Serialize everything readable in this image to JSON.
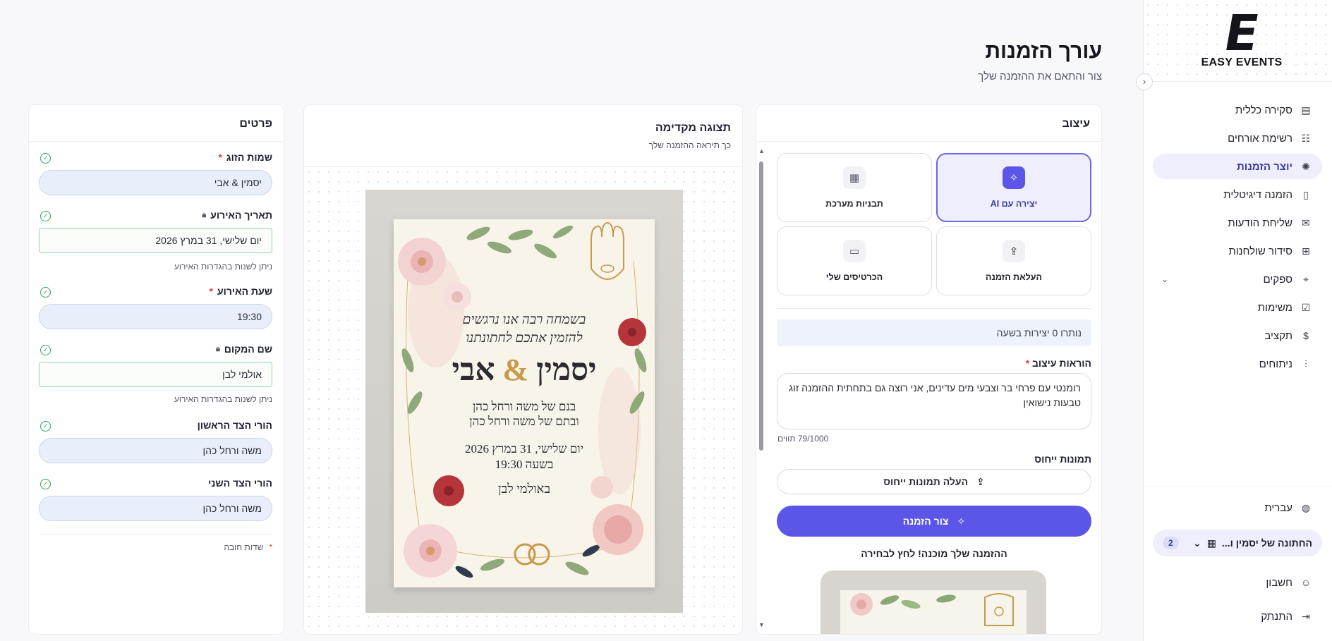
{
  "brand": {
    "logo_mark": "E",
    "logo_text": "EASY EVENTS"
  },
  "sidebar": {
    "collapse_icon": "chevron-left-icon",
    "items": [
      {
        "label": "סקירה כללית",
        "icon": "dashboard-icon",
        "glyph": "▤"
      },
      {
        "label": "רשימת אורחים",
        "icon": "guests-icon",
        "glyph": "☷"
      },
      {
        "label": "יוצר הזמנות",
        "icon": "sparkle-icon",
        "glyph": "✺"
      },
      {
        "label": "הזמנה דיגיטלית",
        "icon": "phone-icon",
        "glyph": "▯"
      },
      {
        "label": "שליחת הודעות",
        "icon": "message-icon",
        "glyph": "✉"
      },
      {
        "label": "סידור שולחנות",
        "icon": "tables-icon",
        "glyph": "⊞"
      },
      {
        "label": "ספקים",
        "icon": "location-icon",
        "glyph": "⌖"
      },
      {
        "label": "משימות",
        "icon": "tasks-icon",
        "glyph": "☑"
      },
      {
        "label": "תקציב",
        "icon": "budget-icon",
        "glyph": "$"
      },
      {
        "label": "ניתוחים",
        "icon": "analytics-icon",
        "glyph": "⫶"
      }
    ],
    "language": "עברית",
    "event_name": "החתונה של יסמין ו...",
    "event_count": "2",
    "account": "חשבון",
    "logout": "התנתק"
  },
  "header": {
    "title": "עורך הזמנות",
    "subtitle": "צור והתאם את ההזמנה שלך"
  },
  "design": {
    "title": "עיצוב",
    "options": [
      {
        "label": "יצירה עם AI",
        "icon": "ai-sparkle-icon",
        "glyph": "✧"
      },
      {
        "label": "תבניות מערכת",
        "icon": "template-icon",
        "glyph": "▦"
      },
      {
        "label": "העלאת הזמנה",
        "icon": "upload-icon",
        "glyph": "⇪"
      },
      {
        "label": "הכרטיסים שלי",
        "icon": "folder-icon",
        "glyph": "▭"
      }
    ],
    "credits": "נותרו 0 יצירות בשעה",
    "instructions_label": "הוראות עיצוב",
    "instructions_value": "רומנטי עם פרחי בר וצבעי מים עדינים, אני רוצה גם בתחתית ההזמנה זוג טבעות נישואין",
    "char_count": "79/1000 תווים",
    "reference_label": "תמונות ייחוס",
    "upload_label": "העלה תמונות ייחוס",
    "create_label": "צור הזמנה",
    "ready_text": "ההזמנה שלך מוכנה! לחץ לבחירה"
  },
  "preview": {
    "title": "תצוגה מקדימה",
    "subtitle": "כך תיראה ההזמנה שלך",
    "card": {
      "line1": "בשמחה רבה אנו נרגשים",
      "line2": "להזמין אתכם לחתונתנו",
      "bride": "יסמין",
      "amp": "&",
      "groom": "אבי",
      "parents1": "בנם של משה ורחל כהן",
      "parents2": "ובתם של משה ורחל כהן",
      "date": "יום שלישי, 31 במרץ 2026",
      "time": "בשעה 19:30",
      "venue": "באולמי לבן"
    }
  },
  "details": {
    "title": "פרטים",
    "fields": {
      "couple_label": "שמות הזוג",
      "couple_value": "יסמין & אבי",
      "date_label": "תאריך האירוע",
      "date_value": "יום שלישי, 31 במרץ 2026",
      "date_hint": "ניתן לשנות בהגדרות האירוע",
      "time_label": "שעת האירוע",
      "time_value": "19:30",
      "venue_label": "שם המקום",
      "venue_value": "אולמי לבן",
      "venue_hint": "ניתן לשנות בהגדרות האירוע",
      "parents1_label": "הורי הצד הראשון",
      "parents1_value": "משה ורחל כהן",
      "parents2_label": "הורי הצד השני",
      "parents2_value": "משה ורחל כהן"
    },
    "required_note": "שדות חובה",
    "required_mark": "*"
  },
  "colors": {
    "accent": "#5b56e8",
    "valid": "#29a85a",
    "required": "#e0443c"
  }
}
